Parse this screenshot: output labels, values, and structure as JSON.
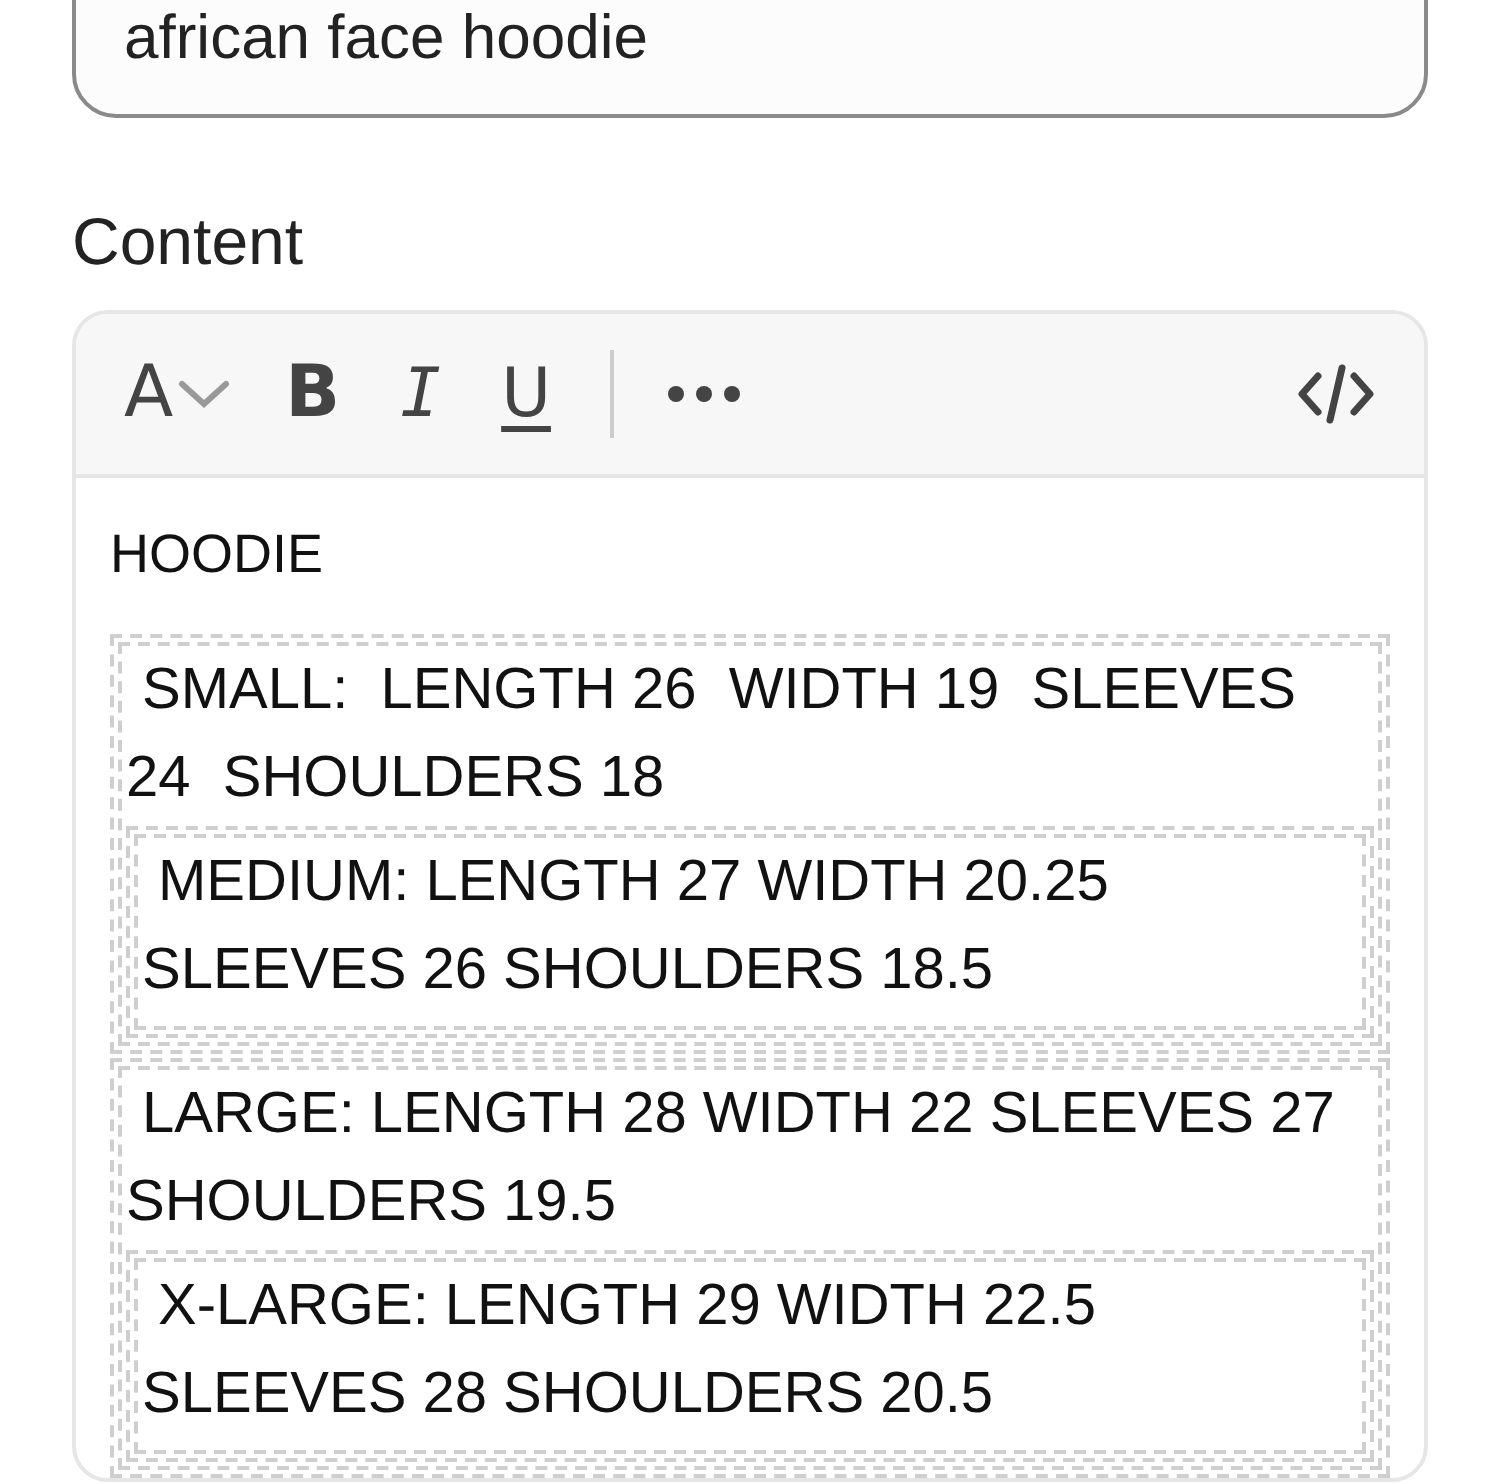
{
  "title_field": {
    "value": "african face hoodie"
  },
  "content_label": "Content",
  "toolbar": [
    {
      "kind": "font",
      "glyph": "A"
    },
    {
      "kind": "bold",
      "glyph": "B"
    },
    {
      "kind": "italic",
      "glyph": "I"
    },
    {
      "kind": "underline",
      "glyph": "U"
    },
    {
      "kind": "divider"
    },
    {
      "kind": "more"
    },
    {
      "kind": "code"
    }
  ],
  "editor": {
    "heading": "HOODIE",
    "tables": [
      {
        "text": "SMALL:  LENGTH 26  WIDTH 19  SLEEVES 24  SHOULDERS 18",
        "nested": "MEDIUM: LENGTH 27 WIDTH 20.25 SLEEVES 26 SHOULDERS 18.5"
      },
      {
        "text": "LARGE: LENGTH 28 WIDTH 22 SLEEVES 27 SHOULDERS 19.5",
        "nested": "X-LARGE: LENGTH 29 WIDTH 22.5 SLEEVES 28 SHOULDERS 20.5"
      }
    ]
  }
}
